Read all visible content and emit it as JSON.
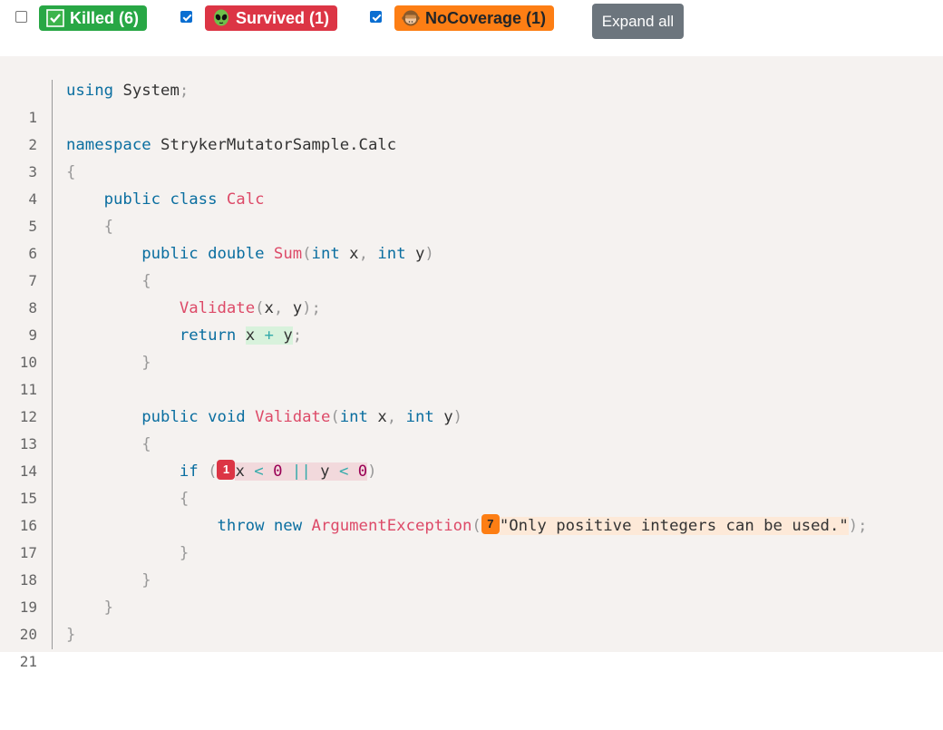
{
  "filters": [
    {
      "id": "killed",
      "label": "Killed (6)",
      "checked": false,
      "icon": "check-box-icon",
      "color": "#28a745"
    },
    {
      "id": "survived",
      "label": "Survived (1)",
      "checked": true,
      "icon": "alien-icon",
      "color": "#dc3545"
    },
    {
      "id": "nocoverage",
      "label": "NoCoverage (1)",
      "checked": true,
      "icon": "monkey-icon",
      "color": "#fd7e14"
    }
  ],
  "expand_button": {
    "label": "Expand all"
  },
  "line_numbers": [
    "1",
    "2",
    "3",
    "4",
    "5",
    "6",
    "7",
    "8",
    "9",
    "10",
    "11",
    "12",
    "13",
    "14",
    "15",
    "16",
    "17",
    "18",
    "19",
    "20",
    "21"
  ],
  "code": {
    "l1": {
      "kw": "using",
      "name": "System",
      "punct": ";"
    },
    "l3": {
      "kw": "namespace",
      "name": "StrykerMutatorSample.Calc"
    },
    "l4": {
      "brace": "{"
    },
    "l5": {
      "kw1": "public",
      "kw2": "class",
      "cls": "Calc"
    },
    "l6": {
      "brace": "{"
    },
    "l7": {
      "kw1": "public",
      "kw2": "double",
      "fn": "Sum",
      "p1": "(",
      "t1": "int",
      "a1": "x",
      "c": ",",
      "t2": "int",
      "a2": "y",
      "p2": ")"
    },
    "l8": {
      "brace": "{"
    },
    "l9": {
      "fn": "Validate",
      "p1": "(",
      "a1": "x",
      "c": ",",
      "a2": "y",
      "p2": ");"
    },
    "l10": {
      "kw": "return",
      "a1": "x",
      "op": "+",
      "a2": "y",
      "punct": ";"
    },
    "l11": {
      "brace": "}"
    },
    "l13": {
      "kw1": "public",
      "kw2": "void",
      "fn": "Validate",
      "p1": "(",
      "t1": "int",
      "a1": "x",
      "c": ",",
      "t2": "int",
      "a2": "y",
      "p2": ")"
    },
    "l14": {
      "brace": "{"
    },
    "l15": {
      "kw": "if",
      "p1": "(",
      "badge": "1",
      "a1": "x",
      "op1": "<",
      "n1": "0",
      "op2": "||",
      "a2": "y",
      "op3": "<",
      "n2": "0",
      "p2": ")"
    },
    "l16": {
      "brace": "{"
    },
    "l17": {
      "kw1": "throw",
      "kw2": "new",
      "cls": "ArgumentException",
      "p1": "(",
      "badge": "7",
      "str": "\"Only positive integers can be used.\"",
      "p2": ");"
    },
    "l18": {
      "brace": "}"
    },
    "l19": {
      "brace": "}"
    },
    "l20": {
      "brace": "}"
    },
    "l21": {
      "brace": "}"
    }
  }
}
